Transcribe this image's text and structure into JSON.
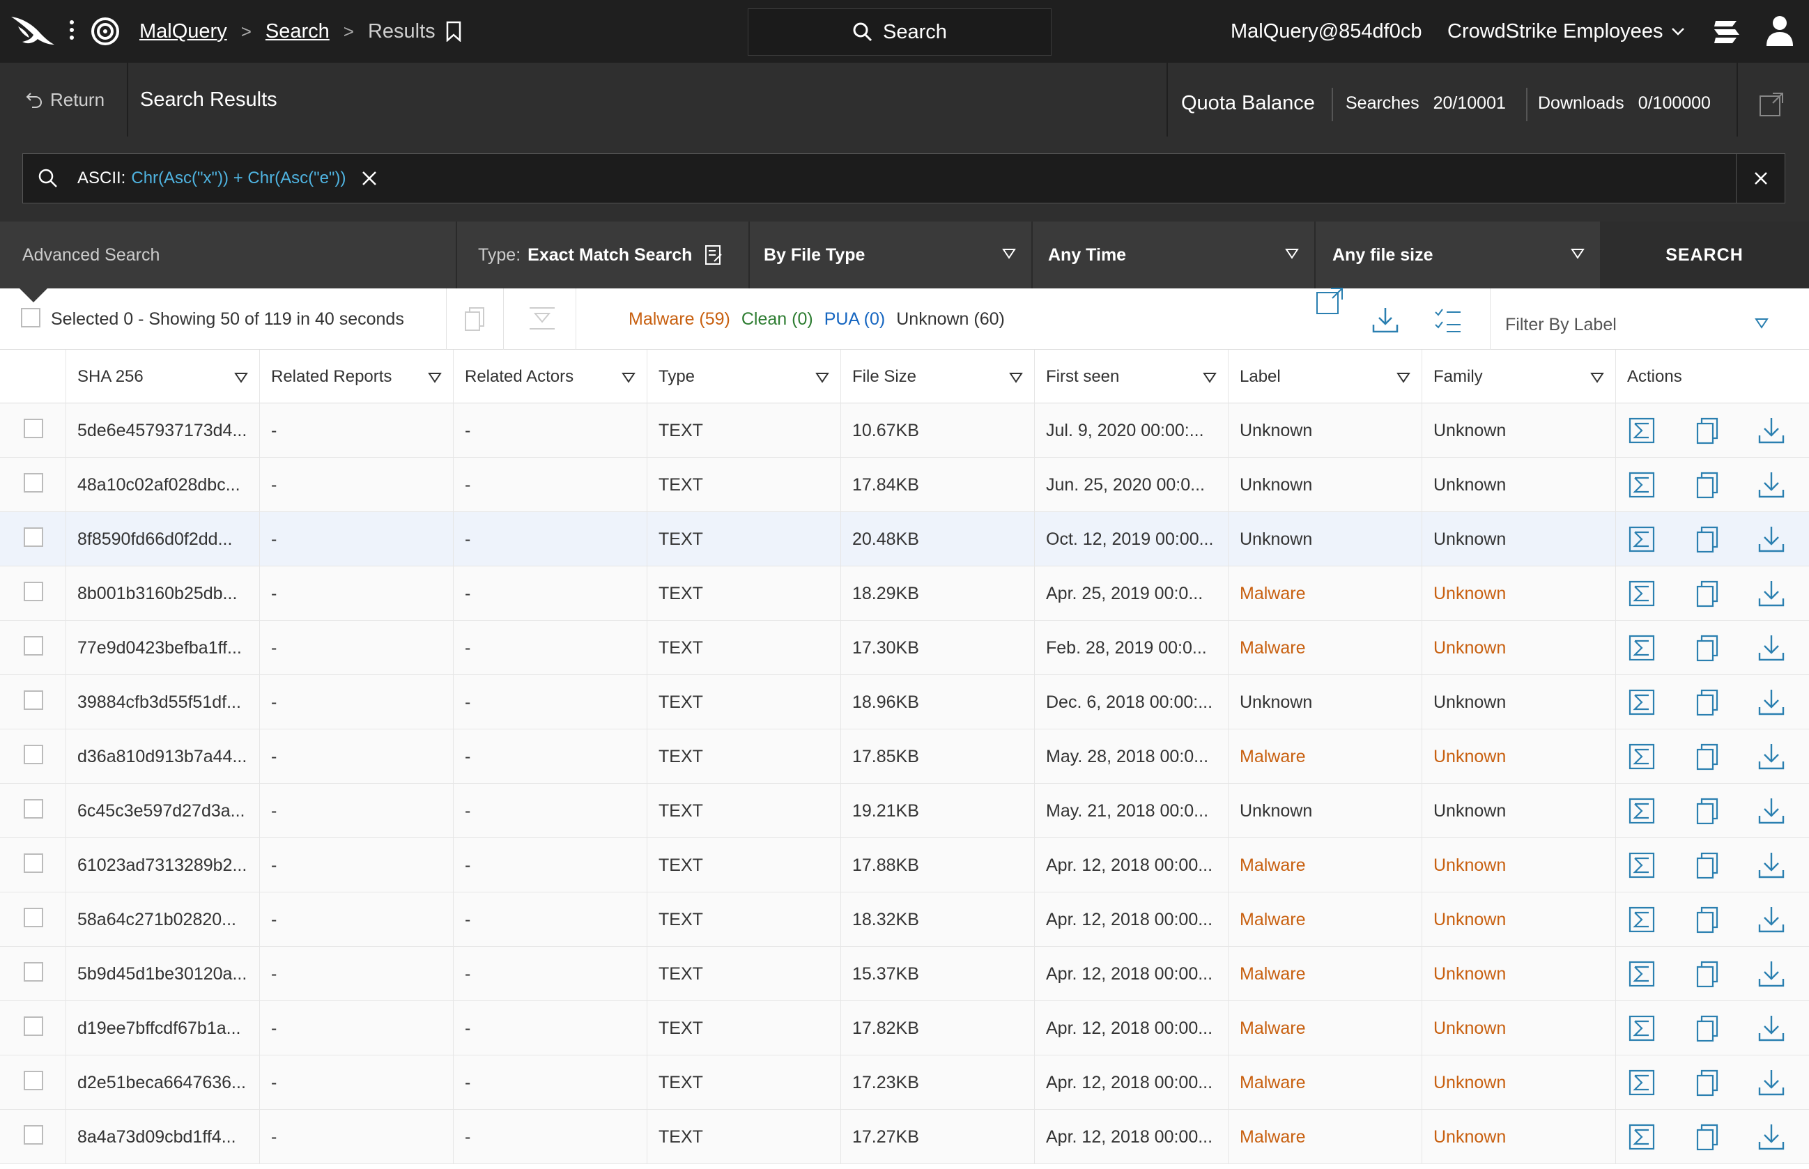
{
  "header": {
    "breadcrumbs": [
      "MalQuery",
      "Search",
      "Results"
    ],
    "search_label": "Search",
    "account": "MalQuery@854df0cb",
    "org": "CrowdStrike Employees"
  },
  "subbar": {
    "return_label": "Return",
    "title": "Search Results",
    "quota_title": "Quota Balance",
    "searches_label": "Searches",
    "searches_value": "20/10001",
    "downloads_label": "Downloads",
    "downloads_value": "0/100000"
  },
  "query": {
    "label": "ASCII:",
    "value": "Chr(Asc(\"x\")) + Chr(Asc(\"e\"))"
  },
  "filters": {
    "advanced": "Advanced Search",
    "type_label": "Type:",
    "type_value": "Exact Match Search",
    "file_type": "By File Type",
    "time": "Any Time",
    "size": "Any file size",
    "search_button": "SEARCH"
  },
  "toolbar": {
    "selection_text": "Selected 0 - Showing 50 of 119 in 40 seconds",
    "malware": "Malware (59)",
    "clean": "Clean (0)",
    "pua": "PUA (0)",
    "unknown": "Unknown (60)",
    "filter_label": "Filter By Label"
  },
  "table": {
    "columns": [
      "SHA 256",
      "Related Reports",
      "Related Actors",
      "Type",
      "File Size",
      "First seen",
      "Label",
      "Family",
      "Actions"
    ],
    "rows": [
      {
        "sha": "5de6e457937173d4...",
        "reports": "-",
        "actors": "-",
        "type": "TEXT",
        "size": "10.67KB",
        "first_seen": "Jul. 9, 2020 00:00:...",
        "label": "Unknown",
        "family": "Unknown",
        "malware": false
      },
      {
        "sha": "48a10c02af028dbc...",
        "reports": "-",
        "actors": "-",
        "type": "TEXT",
        "size": "17.84KB",
        "first_seen": "Jun. 25, 2020 00:0...",
        "label": "Unknown",
        "family": "Unknown",
        "malware": false
      },
      {
        "sha": "8f8590fd66d0f2dd...",
        "reports": "-",
        "actors": "-",
        "type": "TEXT",
        "size": "20.48KB",
        "first_seen": "Oct. 12, 2019 00:00...",
        "label": "Unknown",
        "family": "Unknown",
        "malware": false
      },
      {
        "sha": "8b001b3160b25db...",
        "reports": "-",
        "actors": "-",
        "type": "TEXT",
        "size": "18.29KB",
        "first_seen": "Apr. 25, 2019 00:0...",
        "label": "Malware",
        "family": "Unknown",
        "malware": true
      },
      {
        "sha": "77e9d0423befba1ff...",
        "reports": "-",
        "actors": "-",
        "type": "TEXT",
        "size": "17.30KB",
        "first_seen": "Feb. 28, 2019 00:0...",
        "label": "Malware",
        "family": "Unknown",
        "malware": true
      },
      {
        "sha": "39884cfb3d55f51df...",
        "reports": "-",
        "actors": "-",
        "type": "TEXT",
        "size": "18.96KB",
        "first_seen": "Dec. 6, 2018 00:00:...",
        "label": "Unknown",
        "family": "Unknown",
        "malware": false
      },
      {
        "sha": "d36a810d913b7a44...",
        "reports": "-",
        "actors": "-",
        "type": "TEXT",
        "size": "17.85KB",
        "first_seen": "May. 28, 2018 00:0...",
        "label": "Malware",
        "family": "Unknown",
        "malware": true
      },
      {
        "sha": "6c45c3e597d27d3a...",
        "reports": "-",
        "actors": "-",
        "type": "TEXT",
        "size": "19.21KB",
        "first_seen": "May. 21, 2018 00:0...",
        "label": "Unknown",
        "family": "Unknown",
        "malware": false
      },
      {
        "sha": "61023ad7313289b2...",
        "reports": "-",
        "actors": "-",
        "type": "TEXT",
        "size": "17.88KB",
        "first_seen": "Apr. 12, 2018 00:00...",
        "label": "Malware",
        "family": "Unknown",
        "malware": true
      },
      {
        "sha": "58a64c271b02820...",
        "reports": "-",
        "actors": "-",
        "type": "TEXT",
        "size": "18.32KB",
        "first_seen": "Apr. 12, 2018 00:00...",
        "label": "Malware",
        "family": "Unknown",
        "malware": true
      },
      {
        "sha": "5b9d45d1be30120a...",
        "reports": "-",
        "actors": "-",
        "type": "TEXT",
        "size": "15.37KB",
        "first_seen": "Apr. 12, 2018 00:00...",
        "label": "Malware",
        "family": "Unknown",
        "malware": true
      },
      {
        "sha": "d19ee7bffcdf67b1a...",
        "reports": "-",
        "actors": "-",
        "type": "TEXT",
        "size": "17.82KB",
        "first_seen": "Apr. 12, 2018 00:00...",
        "label": "Malware",
        "family": "Unknown",
        "malware": true
      },
      {
        "sha": "d2e51beca6647636...",
        "reports": "-",
        "actors": "-",
        "type": "TEXT",
        "size": "17.23KB",
        "first_seen": "Apr. 12, 2018 00:00...",
        "label": "Malware",
        "family": "Unknown",
        "malware": true
      },
      {
        "sha": "8a4a73d09cbd1ff4...",
        "reports": "-",
        "actors": "-",
        "type": "TEXT",
        "size": "17.27KB",
        "first_seen": "Apr. 12, 2018 00:00...",
        "label": "Malware",
        "family": "Unknown",
        "malware": true
      }
    ]
  },
  "icons": {
    "logo": "falcon-logo-icon",
    "menu": "kebab-menu-icon",
    "app": "malquery-target-icon",
    "bookmark": "bookmark-icon",
    "search": "search-icon",
    "chevron": "chevron-down-icon",
    "servers": "server-stack-icon",
    "user": "user-icon",
    "return": "return-arrow-icon",
    "expand": "expand-panel-icon",
    "copy": "copy-icon",
    "collapse": "collapse-icon",
    "download": "download-icon",
    "checklist": "checklist-icon",
    "report": "report-sigma-icon"
  },
  "colors": {
    "malware": "#c86010",
    "clean": "#2e7d32",
    "pua": "#1565c0",
    "query_value": "#4fb3e0",
    "action_icon": "#2a7fb0"
  }
}
